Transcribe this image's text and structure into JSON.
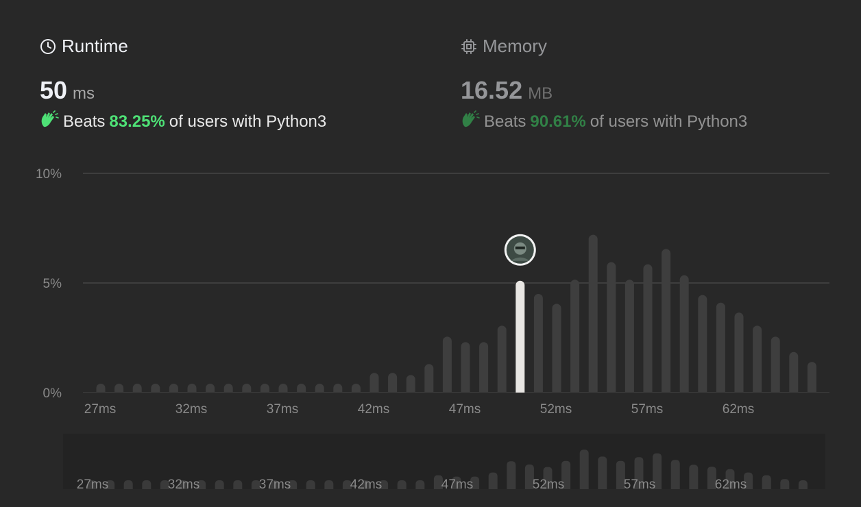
{
  "runtime": {
    "title": "Runtime",
    "value": "50",
    "unit": "ms",
    "beats_prefix": "Beats",
    "beats_pct": "83.25%",
    "beats_suffix": "of users with Python3"
  },
  "memory": {
    "title": "Memory",
    "value": "16.52",
    "unit": "MB",
    "beats_prefix": "Beats",
    "beats_pct": "90.61%",
    "beats_suffix": "of users with Python3"
  },
  "colors": {
    "background": "#282828",
    "bar": "#3e3e3e",
    "highlight_bar": "#e8e6e3",
    "accent_green": "#4ee176"
  },
  "chart_data": {
    "type": "bar",
    "x_unit": "ms",
    "x": [
      27,
      28,
      29,
      30,
      31,
      32,
      33,
      34,
      35,
      36,
      37,
      38,
      39,
      40,
      41,
      42,
      43,
      44,
      45,
      46,
      47,
      48,
      49,
      50,
      51,
      52,
      53,
      54,
      55,
      56,
      57,
      58,
      59,
      60,
      61,
      62,
      63,
      64,
      65,
      66
    ],
    "values": [
      0.15,
      0.15,
      0.15,
      0.15,
      0.15,
      0.15,
      0.15,
      0.15,
      0.15,
      0.15,
      0.15,
      0.15,
      0.15,
      0.15,
      0.3,
      0.9,
      0.9,
      0.8,
      1.3,
      2.55,
      2.3,
      2.3,
      3.05,
      5.1,
      4.5,
      4.05,
      5.15,
      7.2,
      5.95,
      5.15,
      5.85,
      6.55,
      5.35,
      4.45,
      4.1,
      3.65,
      3.05,
      2.55,
      1.85,
      1.4
    ],
    "highlight_x": 50,
    "ylim": [
      0,
      10
    ],
    "y_ticks": [
      "0%",
      "5%",
      "10%"
    ],
    "x_tick_labels": [
      "27ms",
      "32ms",
      "37ms",
      "42ms",
      "47ms",
      "52ms",
      "57ms",
      "62ms"
    ],
    "grid": true
  }
}
